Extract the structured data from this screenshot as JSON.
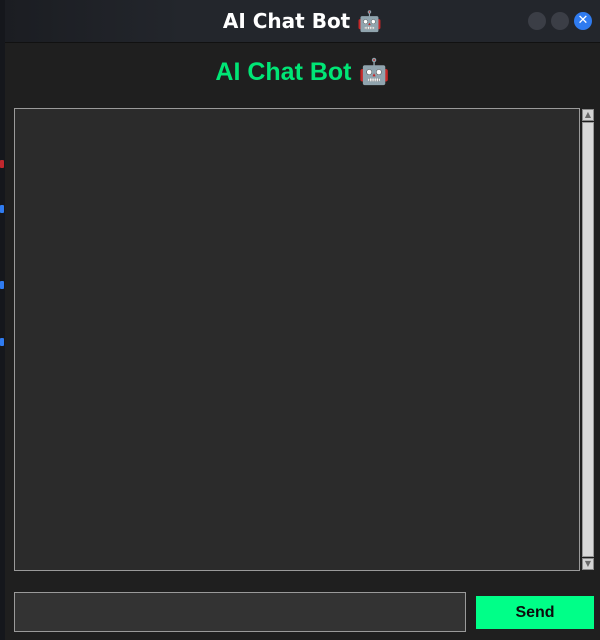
{
  "window": {
    "title": "AI Chat Bot 🤖",
    "controls": [
      {
        "name": "minimize",
        "icon": "minimize-icon"
      },
      {
        "name": "maximize",
        "icon": "maximize-icon"
      },
      {
        "name": "close",
        "icon": "close-icon",
        "glyph": "✕"
      }
    ]
  },
  "header": {
    "title": "AI Chat Bot 🤖"
  },
  "chat": {
    "messages": []
  },
  "input": {
    "value": "",
    "placeholder": ""
  },
  "send": {
    "label": "Send"
  },
  "colors": {
    "accent": "#00e676",
    "send_button": "#00ff88",
    "close_button": "#2f7bf0",
    "background": "#1f1f1f",
    "chat_background": "#2b2b2b"
  }
}
